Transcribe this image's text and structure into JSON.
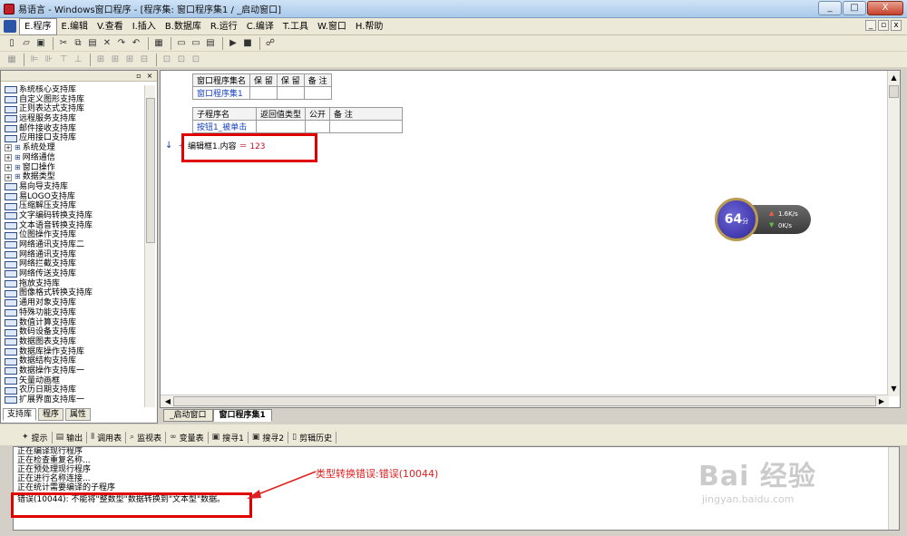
{
  "window": {
    "title": "易语言 - Windows窗口程序 - [程序集: 窗口程序集1 / _启动窗口]",
    "controls": [
      "_",
      "□",
      "X"
    ]
  },
  "menu": {
    "items": [
      "E.程序",
      "E.编辑",
      "V.查看",
      "I.插入",
      "B.数据库",
      "R.运行",
      "C.编译",
      "T.工具",
      "W.窗口",
      "H.帮助"
    ],
    "mdi_controls": [
      "_",
      "▫",
      "x"
    ]
  },
  "left_panel": {
    "libraries": [
      {
        "label": "系统核心支持库",
        "type": "lib"
      },
      {
        "label": "自定义图形支持库",
        "type": "lib"
      },
      {
        "label": "正则表达式支持库",
        "type": "lib"
      },
      {
        "label": "远程服务支持库",
        "type": "lib"
      },
      {
        "label": "邮件接收支持库",
        "type": "lib"
      },
      {
        "label": "应用接口支持库",
        "type": "lib"
      },
      {
        "label": "系统处理",
        "type": "tree"
      },
      {
        "label": "网络通信",
        "type": "tree"
      },
      {
        "label": "窗口操作",
        "type": "tree"
      },
      {
        "label": "数据类型",
        "type": "tree"
      },
      {
        "label": "易向导支持库",
        "type": "lib"
      },
      {
        "label": "易LOGO支持库",
        "type": "lib"
      },
      {
        "label": "压缩解压支持库",
        "type": "lib"
      },
      {
        "label": "文字编码转换支持库",
        "type": "lib"
      },
      {
        "label": "文本语音转换支持库",
        "type": "lib"
      },
      {
        "label": "位图操作支持库",
        "type": "lib"
      },
      {
        "label": "网络通讯支持库二",
        "type": "lib"
      },
      {
        "label": "网络通讯支持库",
        "type": "lib"
      },
      {
        "label": "网络拦截支持库",
        "type": "lib"
      },
      {
        "label": "网络传送支持库",
        "type": "lib"
      },
      {
        "label": "拖放支持库",
        "type": "lib"
      },
      {
        "label": "图像格式转换支持库",
        "type": "lib"
      },
      {
        "label": "通用对象支持库",
        "type": "lib"
      },
      {
        "label": "特殊功能支持库",
        "type": "lib"
      },
      {
        "label": "数值计算支持库",
        "type": "lib"
      },
      {
        "label": "数码设备支持库",
        "type": "lib"
      },
      {
        "label": "数据图表支持库",
        "type": "lib"
      },
      {
        "label": "数据库操作支持库",
        "type": "lib"
      },
      {
        "label": "数据结构支持库",
        "type": "lib"
      },
      {
        "label": "数据操作支持库一",
        "type": "lib"
      },
      {
        "label": "矢量动画框",
        "type": "lib"
      },
      {
        "label": "农历日期支持库",
        "type": "lib"
      },
      {
        "label": "扩展界面支持库一",
        "type": "lib"
      }
    ],
    "tabs": [
      "支持库",
      "程序",
      "属性"
    ]
  },
  "editor": {
    "table1": {
      "headers": [
        "窗口程序集名",
        "保 留",
        "保 留",
        "备 注"
      ],
      "row": [
        "窗口程序集1",
        "",
        "",
        ""
      ]
    },
    "table2": {
      "headers": [
        "子程序名",
        "返回值类型",
        "公开",
        "备 注"
      ],
      "row": [
        "按钮1_被单击",
        "",
        "",
        ""
      ]
    },
    "code": {
      "object": "编辑框1.内容",
      "operator": "＝",
      "value": "123"
    },
    "tabs": [
      "_启动窗口",
      "窗口程序集1"
    ]
  },
  "speed_widget": {
    "score": "64",
    "unit": "分",
    "upload": "1.6K/s",
    "download": "0K/s"
  },
  "bottom_panel": {
    "tabs": [
      "提示",
      "输出",
      "调用表",
      "监视表",
      "变量表",
      "搜寻1",
      "搜寻2",
      "剪辑历史"
    ],
    "output_lines": [
      "正在编译现行程序",
      "正在检查重复名称...",
      "正在预处理现行程序",
      "正在进行名称连接...",
      "正在统计需要编译的子程序",
      "错误(10044): 不能将\"整数型\"数据转换到\"文本型\"数据。"
    ],
    "annotation": "类型转换错误:错误(10044)"
  },
  "watermark": {
    "main": "Bai 经验",
    "sub": "jingyan.baidu.com"
  },
  "colors": {
    "highlight_red": "#e00000",
    "link_blue": "#1540c0"
  }
}
